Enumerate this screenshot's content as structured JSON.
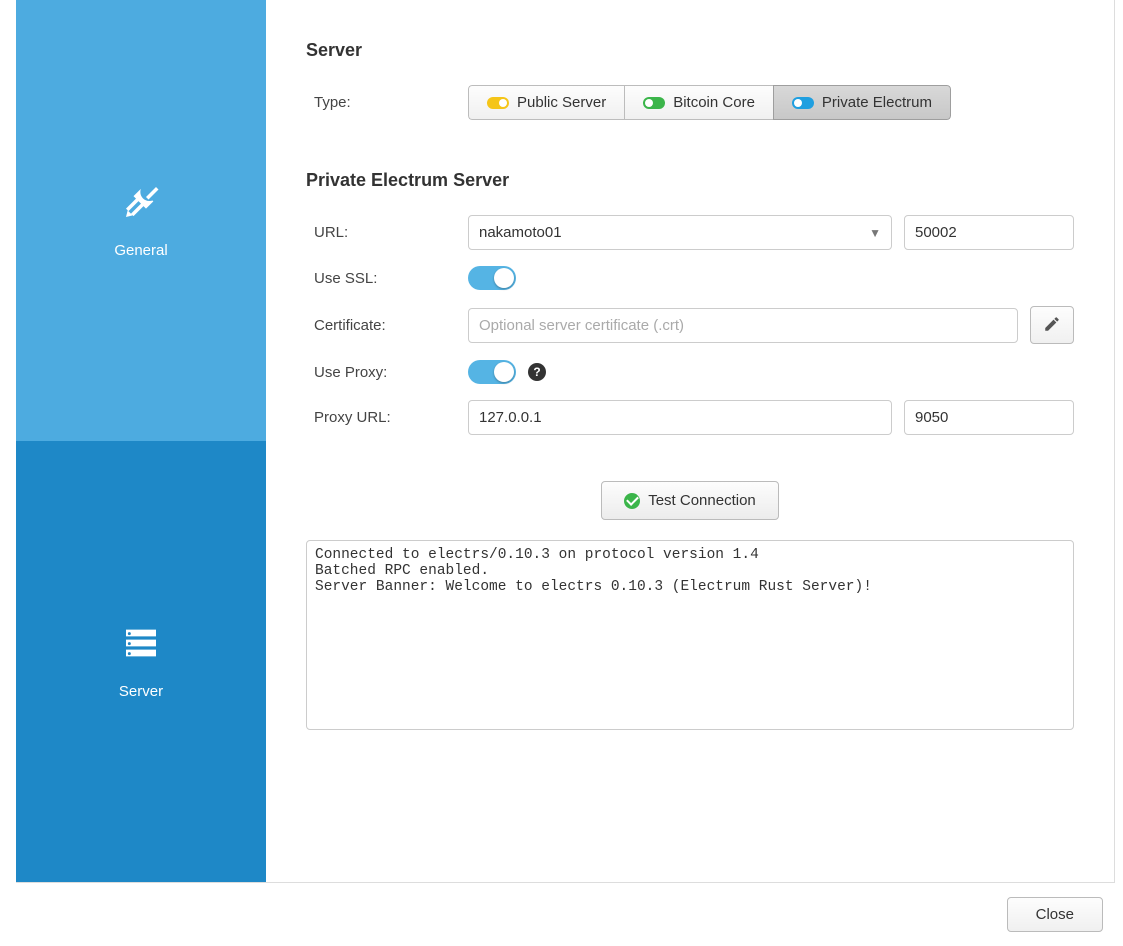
{
  "sidebar": {
    "items": [
      {
        "label": "General",
        "active": true
      },
      {
        "label": "Server",
        "active": false
      }
    ]
  },
  "server_section": {
    "heading": "Server",
    "type_label": "Type:",
    "type_options": [
      {
        "label": "Public Server",
        "color": "yellow",
        "selected": false
      },
      {
        "label": "Bitcoin Core",
        "color": "green",
        "selected": false
      },
      {
        "label": "Private Electrum",
        "color": "blue",
        "selected": true
      }
    ]
  },
  "private_electrum": {
    "heading": "Private Electrum Server",
    "url_label": "URL:",
    "url_value": "nakamoto01",
    "port_value": "50002",
    "use_ssl_label": "Use SSL:",
    "use_ssl_on": true,
    "certificate_label": "Certificate:",
    "certificate_placeholder": "Optional server certificate (.crt)",
    "certificate_value": "",
    "use_proxy_label": "Use Proxy:",
    "use_proxy_on": true,
    "proxy_url_label": "Proxy URL:",
    "proxy_host_value": "127.0.0.1",
    "proxy_port_value": "9050"
  },
  "test_button_label": "Test Connection",
  "output_text": "Connected to electrs/0.10.3 on protocol version 1.4\nBatched RPC enabled.\nServer Banner: Welcome to electrs 0.10.3 (Electrum Rust Server)!",
  "close_button_label": "Close"
}
